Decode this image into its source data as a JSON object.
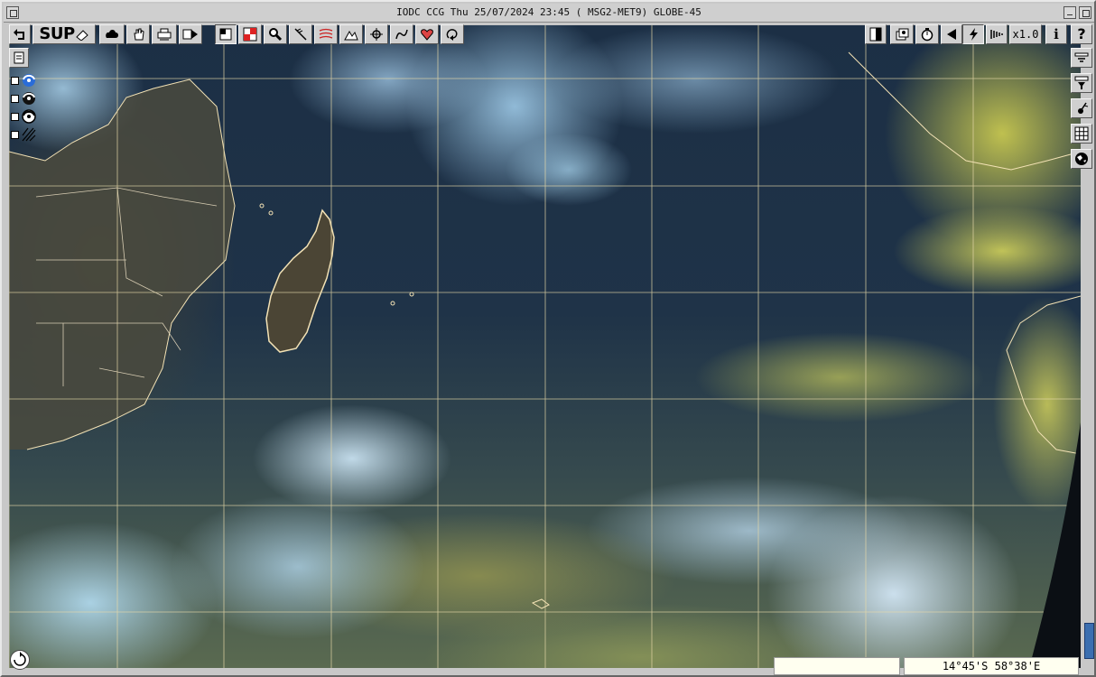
{
  "window": {
    "title": "IODC CCG Thu 25/07/2024 23:45 (      MSG2-MET9) GLOBE-45"
  },
  "toolbar_left": [
    {
      "id": "undo",
      "icon": "undo-arrow-icon",
      "label": ""
    },
    {
      "id": "sup",
      "icon": "sup-eraser-icon",
      "label": "SUP"
    },
    {
      "id": "cloud-tool",
      "icon": "cloud-blob-icon",
      "label": ""
    },
    {
      "id": "pan",
      "icon": "hand-icon",
      "label": ""
    },
    {
      "id": "print",
      "icon": "printer-icon",
      "label": ""
    },
    {
      "id": "animate",
      "icon": "film-arrow-icon",
      "label": ""
    },
    {
      "id": "frame-select",
      "icon": "frame-square-icon",
      "label": "",
      "pressed": true
    },
    {
      "id": "frame-red",
      "icon": "red-frame-icon",
      "label": ""
    },
    {
      "id": "zoom",
      "icon": "magnifier-icon",
      "label": ""
    },
    {
      "id": "wind",
      "icon": "wind-barb-icon",
      "label": ""
    },
    {
      "id": "isobars",
      "icon": "isobar-lines-icon",
      "label": ""
    },
    {
      "id": "terrain",
      "icon": "mountains-icon",
      "label": ""
    },
    {
      "id": "target",
      "icon": "crosshair-icon",
      "label": ""
    },
    {
      "id": "draw-curve",
      "icon": "curve-pen-icon",
      "label": ""
    },
    {
      "id": "overlay",
      "icon": "overlay-heart-icon",
      "label": ""
    },
    {
      "id": "loop",
      "icon": "loop-icon",
      "label": ""
    }
  ],
  "toolbar_right": [
    {
      "id": "contrast",
      "icon": "contrast-half-icon",
      "label": ""
    },
    {
      "id": "layers-config",
      "icon": "layers-gear-icon",
      "label": ""
    },
    {
      "id": "timer",
      "icon": "stopwatch-icon",
      "label": ""
    },
    {
      "id": "prev",
      "icon": "triangle-left-icon",
      "label": ""
    },
    {
      "id": "lightning",
      "icon": "lightning-bolt-icon",
      "label": ""
    },
    {
      "id": "speed",
      "icon": "speed-lines-icon",
      "label": ""
    },
    {
      "id": "zoom-level",
      "icon": "",
      "label": "x1.0"
    },
    {
      "id": "info",
      "icon": "info-icon",
      "label": "i"
    },
    {
      "id": "help",
      "icon": "question-icon",
      "label": "?"
    }
  ],
  "side_left_top": {
    "icon": "notepad-icon"
  },
  "side_right": [
    {
      "id": "product-1",
      "icon": "product-menu-icon"
    },
    {
      "id": "product-2",
      "icon": "product-filter-icon"
    },
    {
      "id": "surface-obs",
      "icon": "station-model-icon"
    },
    {
      "id": "grid",
      "icon": "grid-icon"
    },
    {
      "id": "globe",
      "icon": "globe-icon"
    }
  ],
  "layers": [
    {
      "id": "layer-cyclone",
      "icon": "cyclone-blue-icon",
      "checked": false
    },
    {
      "id": "layer-cyclone-black",
      "icon": "cyclone-black-icon",
      "checked": false
    },
    {
      "id": "layer-cyclone-outline",
      "icon": "cyclone-outline-icon",
      "checked": false
    },
    {
      "id": "layer-hatch",
      "icon": "hatch-pattern-icon",
      "checked": false
    }
  ],
  "status": {
    "coordinates": "14°45'S 58°38'E"
  },
  "colors": {
    "grid": "#e6d9a8",
    "coastline": "#f3e2b5",
    "toolbar_bg": "#d0d0d0",
    "status_bg": "#fffff0",
    "scroll_accent": "#3b6fb0"
  }
}
